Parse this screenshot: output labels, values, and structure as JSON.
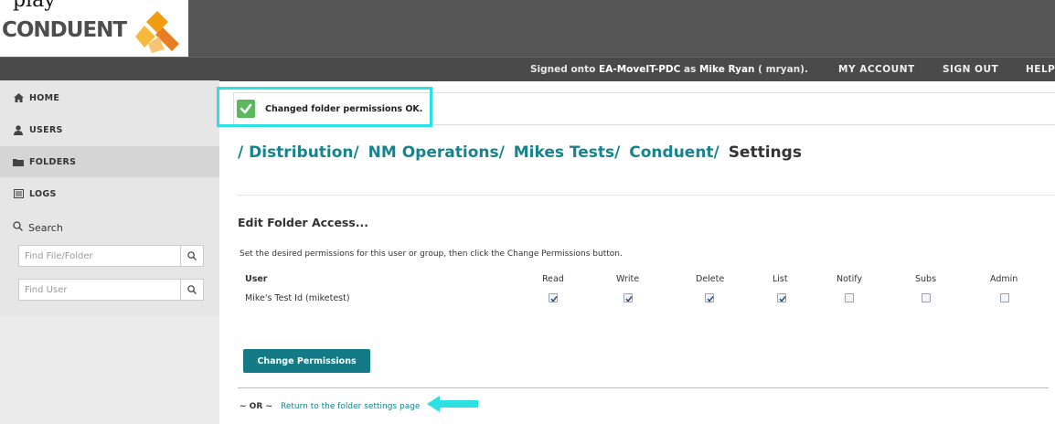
{
  "header": {
    "logo_text": "CONDUENT",
    "stray_text": "play",
    "signed_prefix": "Signed onto ",
    "signed_host": "EA-MoveIT-PDC",
    "signed_as": " as ",
    "signed_user": "Mike Ryan",
    "signed_id": " ( mryan).",
    "my_account": "MY ACCOUNT",
    "sign_out": "SIGN OUT",
    "help": "HELP"
  },
  "sidebar": {
    "items": [
      {
        "label": "HOME",
        "icon": "home-icon"
      },
      {
        "label": "USERS",
        "icon": "user-icon"
      },
      {
        "label": "FOLDERS",
        "icon": "folder-icon"
      },
      {
        "label": "LOGS",
        "icon": "logs-icon"
      }
    ],
    "search_label": "Search",
    "find_file_placeholder": "Find File/Folder",
    "find_user_placeholder": "Find User"
  },
  "alert": {
    "message": "Changed folder permissions OK."
  },
  "breadcrumb": {
    "parts": [
      "/ Distribution/",
      "NM Operations/",
      "Mikes Tests/",
      "Conduent/"
    ],
    "current": "Settings"
  },
  "section": {
    "title": "Edit Folder Access...",
    "instructions": "Set the desired permissions for this user or group, then click the Change Permissions button."
  },
  "permissions": {
    "columns": [
      "User",
      "Read",
      "Write",
      "Delete",
      "List",
      "Notify",
      "Subs",
      "Admin"
    ],
    "rows": [
      {
        "user": "Mike's Test Id (miketest)",
        "read": true,
        "write": true,
        "delete": true,
        "list": true,
        "notify": false,
        "subs": false,
        "admin": false
      }
    ]
  },
  "actions": {
    "change_permissions": "Change Permissions",
    "or_text": "~ OR ~",
    "return_link": "Return to the folder settings page"
  },
  "colors": {
    "accent": "#16838f",
    "button": "#147a85",
    "highlight": "#2de0e3",
    "success": "#5cb85c"
  }
}
